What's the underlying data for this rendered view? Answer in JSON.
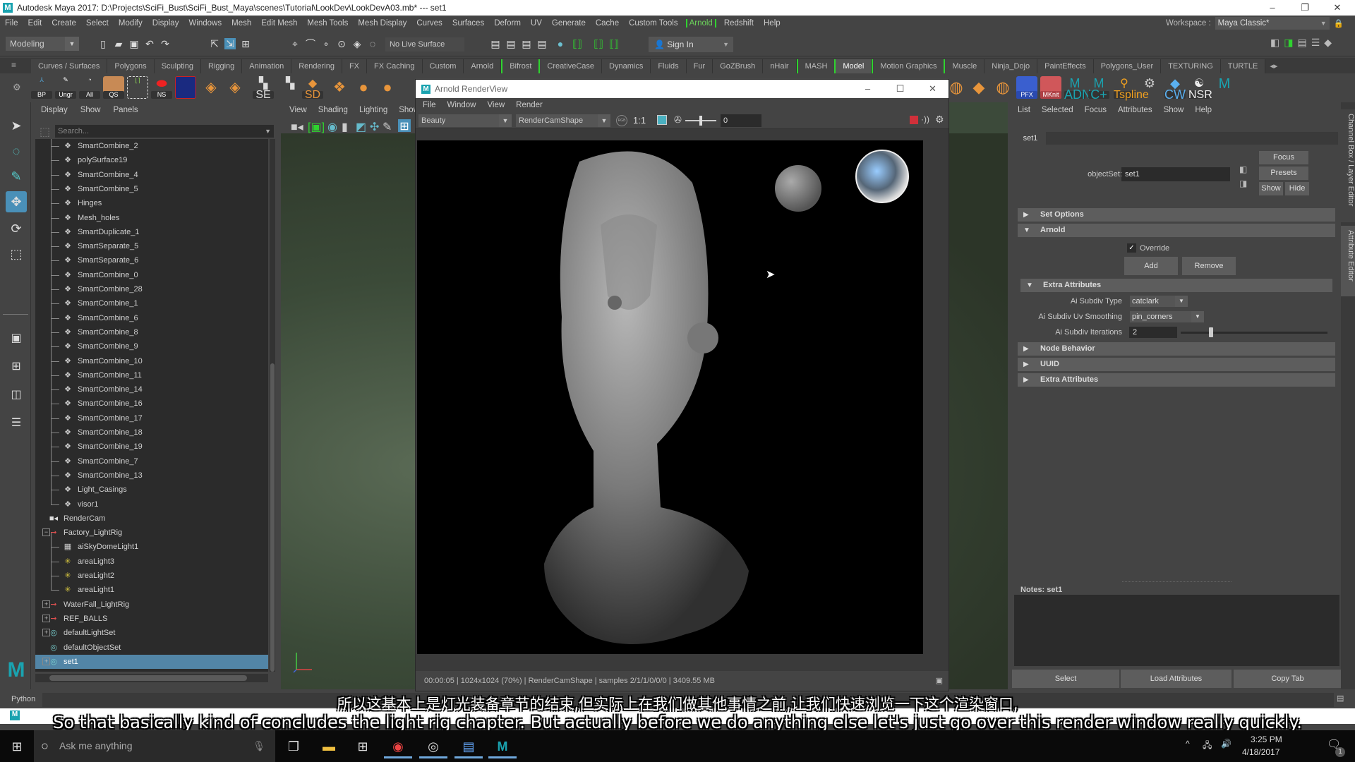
{
  "window": {
    "title": "Autodesk Maya 2017: D:\\Projects\\SciFi_Bust\\SciFi_Bust_Maya\\scenes\\Tutorial\\LookDev\\LookDevA03.mb*  ---  set1",
    "minimize": "–",
    "maximize": "❐",
    "close": "✕"
  },
  "menubar": {
    "items": [
      "File",
      "Edit",
      "Create",
      "Select",
      "Modify",
      "Display",
      "Windows",
      "Mesh",
      "Edit Mesh",
      "Mesh Tools",
      "Mesh Display",
      "Curves",
      "Surfaces",
      "Deform",
      "UV",
      "Generate",
      "Cache",
      "Custom Tools",
      "Arnold",
      "Redshift",
      "Help"
    ],
    "workspace_label": "Workspace :",
    "workspace_value": "Maya Classic*"
  },
  "statusline": {
    "mode": "Modeling",
    "live_surface": "No Live Surface",
    "sign_in": "Sign In"
  },
  "shelf": {
    "tabs": [
      "Curves / Surfaces",
      "Polygons",
      "Sculpting",
      "Rigging",
      "Animation",
      "Rendering",
      "FX",
      "FX Caching",
      "Custom",
      "Arnold",
      "Bifrost",
      "CreativeCase",
      "Dynamics",
      "Fluids",
      "Fur",
      "GoZBrush",
      "nHair",
      "MASH",
      "Model",
      "Motion Graphics",
      "Muscle",
      "Ninja_Dojo",
      "PaintEffects",
      "Polygons_User",
      "TEXTURING",
      "TURTLE"
    ],
    "active_tab": "Model",
    "left_buttons": [
      "BP",
      "Ungr",
      "All",
      "QS",
      "",
      "NS",
      "",
      "",
      "",
      "",
      "SE",
      "",
      "SD"
    ],
    "right_buttons": [
      "PFX",
      "MKnit",
      "ADN",
      "C+",
      "Tspline",
      "",
      "CW",
      "NSR",
      ""
    ]
  },
  "outliner": {
    "menu": [
      "Display",
      "Show",
      "Panels"
    ],
    "search_placeholder": "Search...",
    "items": [
      {
        "label": "SmartCombine_2",
        "icon": "mesh-icon",
        "indent": 1
      },
      {
        "label": "polySurface19",
        "icon": "mesh-icon",
        "indent": 1
      },
      {
        "label": "SmartCombine_4",
        "icon": "mesh-icon",
        "indent": 1
      },
      {
        "label": "SmartCombine_5",
        "icon": "mesh-icon",
        "indent": 1
      },
      {
        "label": "Hinges",
        "icon": "mesh-icon",
        "indent": 1
      },
      {
        "label": "Mesh_holes",
        "icon": "mesh-icon",
        "indent": 1
      },
      {
        "label": "SmartDuplicate_1",
        "icon": "mesh-icon",
        "indent": 1
      },
      {
        "label": "SmartSeparate_5",
        "icon": "mesh-icon",
        "indent": 1
      },
      {
        "label": "SmartSeparate_6",
        "icon": "mesh-icon",
        "indent": 1
      },
      {
        "label": "SmartCombine_0",
        "icon": "mesh-icon",
        "indent": 1
      },
      {
        "label": "SmartCombine_28",
        "icon": "mesh-icon",
        "indent": 1
      },
      {
        "label": "SmartCombine_1",
        "icon": "mesh-icon",
        "indent": 1
      },
      {
        "label": "SmartCombine_6",
        "icon": "mesh-icon",
        "indent": 1
      },
      {
        "label": "SmartCombine_8",
        "icon": "mesh-icon",
        "indent": 1
      },
      {
        "label": "SmartCombine_9",
        "icon": "mesh-icon",
        "indent": 1
      },
      {
        "label": "SmartCombine_10",
        "icon": "mesh-icon",
        "indent": 1
      },
      {
        "label": "SmartCombine_11",
        "icon": "mesh-icon",
        "indent": 1
      },
      {
        "label": "SmartCombine_14",
        "icon": "mesh-icon",
        "indent": 1
      },
      {
        "label": "SmartCombine_16",
        "icon": "mesh-icon",
        "indent": 1
      },
      {
        "label": "SmartCombine_17",
        "icon": "mesh-icon",
        "indent": 1
      },
      {
        "label": "SmartCombine_18",
        "icon": "mesh-icon",
        "indent": 1
      },
      {
        "label": "SmartCombine_19",
        "icon": "mesh-icon",
        "indent": 1
      },
      {
        "label": "SmartCombine_7",
        "icon": "mesh-icon",
        "indent": 1
      },
      {
        "label": "SmartCombine_13",
        "icon": "mesh-icon",
        "indent": 1
      },
      {
        "label": "Light_Casings",
        "icon": "mesh-icon",
        "indent": 1
      },
      {
        "label": "visor1",
        "icon": "mesh-icon",
        "indent": 1
      },
      {
        "label": "RenderCam",
        "icon": "camera-icon",
        "indent": 0
      },
      {
        "label": "Factory_LightRig",
        "icon": "group-icon",
        "indent": 0,
        "expander": "−"
      },
      {
        "label": "aiSkyDomeLight1",
        "icon": "skydome-light-icon",
        "indent": 1
      },
      {
        "label": "areaLight3",
        "icon": "area-light-icon",
        "indent": 1
      },
      {
        "label": "areaLight2",
        "icon": "area-light-icon",
        "indent": 1
      },
      {
        "label": "areaLight1",
        "icon": "area-light-icon",
        "indent": 1
      },
      {
        "label": "WaterFall_LightRig",
        "icon": "group-icon",
        "indent": 0,
        "expander": "+"
      },
      {
        "label": "REF_BALLS",
        "icon": "group-icon",
        "indent": 0,
        "expander": "+"
      },
      {
        "label": "defaultLightSet",
        "icon": "set-icon",
        "indent": 0,
        "expander": "+"
      },
      {
        "label": "defaultObjectSet",
        "icon": "set-icon",
        "indent": 0
      },
      {
        "label": "set1",
        "icon": "set-icon",
        "indent": 0,
        "expander": "+",
        "selected": true
      }
    ]
  },
  "viewport": {
    "menu": [
      "View",
      "Shading",
      "Lighting",
      "Show"
    ]
  },
  "renderview": {
    "title": "Arnold RenderView",
    "menu": [
      "File",
      "Window",
      "View",
      "Render"
    ],
    "aov": "Beauty",
    "camera": "RenderCamShape",
    "rgb_label": "RGB",
    "ratio": "1:1",
    "exposure": "0",
    "status": "00:00:05 | 1024x1024 (70%) | RenderCamShape  | samples 2/1/1/0/0/0 | 3409.55 MB",
    "stop_color": "#d0303a"
  },
  "attribute_editor": {
    "menu": [
      "List",
      "Selected",
      "Focus",
      "Attributes",
      "Show",
      "Help"
    ],
    "tab": "set1",
    "objectset_label": "objectSet:",
    "objectset_value": "set1",
    "focus": "Focus",
    "presets": "Presets",
    "show": "Show",
    "hide": "Hide",
    "sections": {
      "set_options": "Set Options",
      "arnold": "Arnold",
      "override": "Override",
      "override_checked": true,
      "add": "Add",
      "remove": "Remove",
      "extra_attributes": "Extra Attributes",
      "subdiv_type_label": "Ai Subdiv Type",
      "subdiv_type_value": "catclark",
      "uv_smoothing_label": "Ai Subdiv Uv Smoothing",
      "uv_smoothing_value": "pin_corners",
      "iterations_label": "Ai Subdiv Iterations",
      "iterations_value": "2",
      "node_behavior": "Node Behavior",
      "uuid": "UUID",
      "extra_attributes_2": "Extra Attributes"
    },
    "notes_label": "Notes:  set1",
    "select": "Select",
    "load_attributes": "Load Attributes",
    "copy_tab": "Copy Tab"
  },
  "side_tabs": {
    "channel_box": "Channel Box / Layer Editor",
    "attribute_editor": "Attribute Editor"
  },
  "commandline": {
    "language": "Python"
  },
  "subtitles": {
    "chinese": "所以这基本上是灯光装备章节的结束,但实际上在我们做其他事情之前,让我们快速浏览一下这个渲染窗口,",
    "english": "So that basically kind of concludes the light rig chapter. But actually before we do anything else let's just go over this render window really quickly."
  },
  "taskbar": {
    "search_placeholder": "Ask me anything",
    "time": "3:25 PM",
    "date": "4/18/2017",
    "notifications": "1"
  }
}
